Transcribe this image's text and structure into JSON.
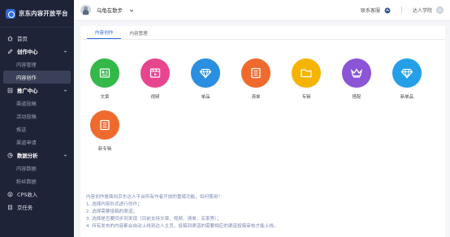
{
  "sidebar": {
    "logo_text": "京东内容开放平台",
    "items": [
      {
        "type": "item",
        "label": "首页",
        "icon": "home-icon"
      },
      {
        "type": "group",
        "label": "创作中心",
        "icon": "pen-icon"
      },
      {
        "type": "sub",
        "label": "内容管理",
        "active": false
      },
      {
        "type": "sub",
        "label": "内容创作",
        "active": true
      },
      {
        "type": "group",
        "label": "推广中心",
        "icon": "promo-icon"
      },
      {
        "type": "sub",
        "label": "渠道投稿",
        "active": false
      },
      {
        "type": "sub",
        "label": "活动投稿",
        "active": false
      },
      {
        "type": "sub",
        "label": "推送",
        "active": false
      },
      {
        "type": "sub",
        "label": "渠道申请",
        "active": false
      },
      {
        "type": "group",
        "label": "数据分析",
        "icon": "chart-icon"
      },
      {
        "type": "sub",
        "label": "内容数据",
        "active": false
      },
      {
        "type": "sub",
        "label": "粉丝数据",
        "active": false
      },
      {
        "type": "item",
        "label": "CPS收入",
        "icon": "money-icon"
      },
      {
        "type": "item",
        "label": "京任务",
        "icon": "task-icon"
      }
    ]
  },
  "header": {
    "account_name": "乌龟在散步",
    "contact_label": "联系客服",
    "academy_label": "达人学院"
  },
  "tabs": [
    {
      "label": "内容创作",
      "active": true
    },
    {
      "label": "内容管理",
      "active": false
    }
  ],
  "tiles": [
    {
      "label": "文章",
      "color": "#35b84a",
      "icon": "article-icon"
    },
    {
      "label": "视频",
      "color": "#e8458f",
      "icon": "video-icon"
    },
    {
      "label": "单品",
      "color": "#2a8fe0",
      "icon": "diamond-icon"
    },
    {
      "label": "清单",
      "color": "#ef6a2d",
      "icon": "list-icon"
    },
    {
      "label": "专辑",
      "color": "#f5b400",
      "icon": "folder-icon"
    },
    {
      "label": "搭配",
      "color": "#8a55d6",
      "icon": "crown-icon"
    },
    {
      "label": "新单品",
      "color": "#25a0e8",
      "icon": "diamond-icon"
    },
    {
      "label": "新专辑",
      "color": "#ef6a2d",
      "icon": "list-icon"
    }
  ],
  "help": {
    "lines": [
      "内容创作是面向京东达人平台所有作者开放的重磅功能，如何使用？",
      "1. 选择内容形式进行创作；",
      "2. 选择需要投稿的渠道；",
      "3. 选择是否要同步到发现（目前支持文章、视频、清单、买家秀）；",
      "4. 所有发布的内容都会自动上线到达人主页，投稿到渠道的需要相应的渠道投稿审核才能上线。"
    ]
  }
}
